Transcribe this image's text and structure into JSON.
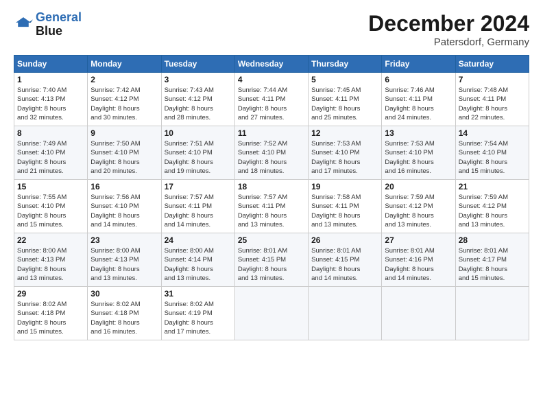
{
  "logo": {
    "line1": "General",
    "line2": "Blue"
  },
  "title": "December 2024",
  "location": "Patersdorf, Germany",
  "weekdays": [
    "Sunday",
    "Monday",
    "Tuesday",
    "Wednesday",
    "Thursday",
    "Friday",
    "Saturday"
  ],
  "weeks": [
    [
      {
        "day": "1",
        "detail": "Sunrise: 7:40 AM\nSunset: 4:13 PM\nDaylight: 8 hours\nand 32 minutes."
      },
      {
        "day": "2",
        "detail": "Sunrise: 7:42 AM\nSunset: 4:12 PM\nDaylight: 8 hours\nand 30 minutes."
      },
      {
        "day": "3",
        "detail": "Sunrise: 7:43 AM\nSunset: 4:12 PM\nDaylight: 8 hours\nand 28 minutes."
      },
      {
        "day": "4",
        "detail": "Sunrise: 7:44 AM\nSunset: 4:11 PM\nDaylight: 8 hours\nand 27 minutes."
      },
      {
        "day": "5",
        "detail": "Sunrise: 7:45 AM\nSunset: 4:11 PM\nDaylight: 8 hours\nand 25 minutes."
      },
      {
        "day": "6",
        "detail": "Sunrise: 7:46 AM\nSunset: 4:11 PM\nDaylight: 8 hours\nand 24 minutes."
      },
      {
        "day": "7",
        "detail": "Sunrise: 7:48 AM\nSunset: 4:11 PM\nDaylight: 8 hours\nand 22 minutes."
      }
    ],
    [
      {
        "day": "8",
        "detail": "Sunrise: 7:49 AM\nSunset: 4:10 PM\nDaylight: 8 hours\nand 21 minutes."
      },
      {
        "day": "9",
        "detail": "Sunrise: 7:50 AM\nSunset: 4:10 PM\nDaylight: 8 hours\nand 20 minutes."
      },
      {
        "day": "10",
        "detail": "Sunrise: 7:51 AM\nSunset: 4:10 PM\nDaylight: 8 hours\nand 19 minutes."
      },
      {
        "day": "11",
        "detail": "Sunrise: 7:52 AM\nSunset: 4:10 PM\nDaylight: 8 hours\nand 18 minutes."
      },
      {
        "day": "12",
        "detail": "Sunrise: 7:53 AM\nSunset: 4:10 PM\nDaylight: 8 hours\nand 17 minutes."
      },
      {
        "day": "13",
        "detail": "Sunrise: 7:53 AM\nSunset: 4:10 PM\nDaylight: 8 hours\nand 16 minutes."
      },
      {
        "day": "14",
        "detail": "Sunrise: 7:54 AM\nSunset: 4:10 PM\nDaylight: 8 hours\nand 15 minutes."
      }
    ],
    [
      {
        "day": "15",
        "detail": "Sunrise: 7:55 AM\nSunset: 4:10 PM\nDaylight: 8 hours\nand 15 minutes."
      },
      {
        "day": "16",
        "detail": "Sunrise: 7:56 AM\nSunset: 4:10 PM\nDaylight: 8 hours\nand 14 minutes."
      },
      {
        "day": "17",
        "detail": "Sunrise: 7:57 AM\nSunset: 4:11 PM\nDaylight: 8 hours\nand 14 minutes."
      },
      {
        "day": "18",
        "detail": "Sunrise: 7:57 AM\nSunset: 4:11 PM\nDaylight: 8 hours\nand 13 minutes."
      },
      {
        "day": "19",
        "detail": "Sunrise: 7:58 AM\nSunset: 4:11 PM\nDaylight: 8 hours\nand 13 minutes."
      },
      {
        "day": "20",
        "detail": "Sunrise: 7:59 AM\nSunset: 4:12 PM\nDaylight: 8 hours\nand 13 minutes."
      },
      {
        "day": "21",
        "detail": "Sunrise: 7:59 AM\nSunset: 4:12 PM\nDaylight: 8 hours\nand 13 minutes."
      }
    ],
    [
      {
        "day": "22",
        "detail": "Sunrise: 8:00 AM\nSunset: 4:13 PM\nDaylight: 8 hours\nand 13 minutes."
      },
      {
        "day": "23",
        "detail": "Sunrise: 8:00 AM\nSunset: 4:13 PM\nDaylight: 8 hours\nand 13 minutes."
      },
      {
        "day": "24",
        "detail": "Sunrise: 8:00 AM\nSunset: 4:14 PM\nDaylight: 8 hours\nand 13 minutes."
      },
      {
        "day": "25",
        "detail": "Sunrise: 8:01 AM\nSunset: 4:15 PM\nDaylight: 8 hours\nand 13 minutes."
      },
      {
        "day": "26",
        "detail": "Sunrise: 8:01 AM\nSunset: 4:15 PM\nDaylight: 8 hours\nand 14 minutes."
      },
      {
        "day": "27",
        "detail": "Sunrise: 8:01 AM\nSunset: 4:16 PM\nDaylight: 8 hours\nand 14 minutes."
      },
      {
        "day": "28",
        "detail": "Sunrise: 8:01 AM\nSunset: 4:17 PM\nDaylight: 8 hours\nand 15 minutes."
      }
    ],
    [
      {
        "day": "29",
        "detail": "Sunrise: 8:02 AM\nSunset: 4:18 PM\nDaylight: 8 hours\nand 15 minutes."
      },
      {
        "day": "30",
        "detail": "Sunrise: 8:02 AM\nSunset: 4:18 PM\nDaylight: 8 hours\nand 16 minutes."
      },
      {
        "day": "31",
        "detail": "Sunrise: 8:02 AM\nSunset: 4:19 PM\nDaylight: 8 hours\nand 17 minutes."
      },
      null,
      null,
      null,
      null
    ]
  ]
}
